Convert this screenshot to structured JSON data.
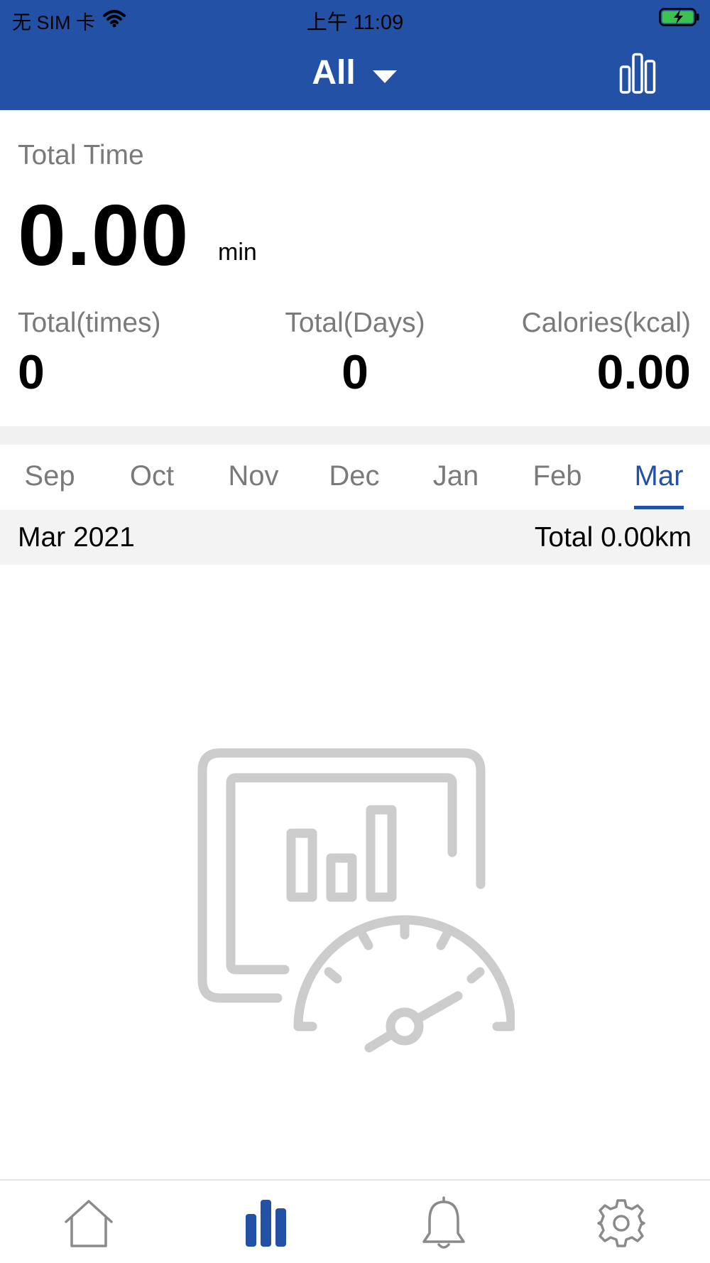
{
  "status_bar": {
    "carrier": "无 SIM 卡",
    "time": "上午 11:09"
  },
  "header": {
    "filter_label": "All",
    "filter_icon": "caret-down-icon",
    "chart_toggle_icon": "bar-chart-icon",
    "background_color": "#2251a5"
  },
  "summary": {
    "total_time_label": "Total Time",
    "total_time_value": "0.00",
    "total_time_unit": "min",
    "stats": [
      {
        "label": "Total(times)",
        "value": "0"
      },
      {
        "label": "Total(Days)",
        "value": "0"
      },
      {
        "label": "Calories(kcal)",
        "value": "0.00"
      }
    ]
  },
  "months": {
    "items": [
      "Sep",
      "Oct",
      "Nov",
      "Dec",
      "Jan",
      "Feb",
      "Mar"
    ],
    "selected": "Mar",
    "active_color": "#2251a5"
  },
  "period": {
    "label": "Mar 2021",
    "total": "Total 0.00km"
  },
  "empty_state": {
    "icon": "no-data-speedometer-chart-icon"
  },
  "tabbar": {
    "items": [
      {
        "name": "home",
        "icon": "home-icon",
        "active": false
      },
      {
        "name": "statistics",
        "icon": "bar-chart-icon",
        "active": true
      },
      {
        "name": "notifications",
        "icon": "bell-icon",
        "active": false
      },
      {
        "name": "settings",
        "icon": "gear-icon",
        "active": false
      }
    ]
  }
}
